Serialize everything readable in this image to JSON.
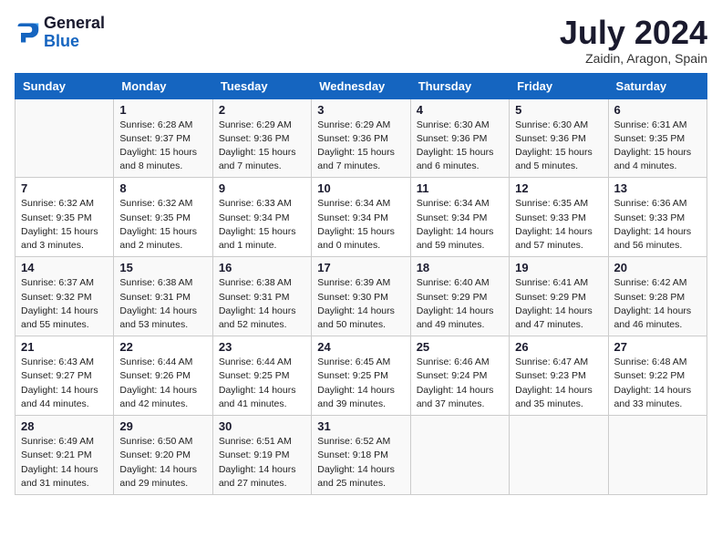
{
  "header": {
    "logo_line1": "General",
    "logo_line2": "Blue",
    "month": "July 2024",
    "location": "Zaidin, Aragon, Spain"
  },
  "days_of_week": [
    "Sunday",
    "Monday",
    "Tuesday",
    "Wednesday",
    "Thursday",
    "Friday",
    "Saturday"
  ],
  "weeks": [
    [
      {
        "num": "",
        "detail": ""
      },
      {
        "num": "1",
        "detail": "Sunrise: 6:28 AM\nSunset: 9:37 PM\nDaylight: 15 hours\nand 8 minutes."
      },
      {
        "num": "2",
        "detail": "Sunrise: 6:29 AM\nSunset: 9:36 PM\nDaylight: 15 hours\nand 7 minutes."
      },
      {
        "num": "3",
        "detail": "Sunrise: 6:29 AM\nSunset: 9:36 PM\nDaylight: 15 hours\nand 7 minutes."
      },
      {
        "num": "4",
        "detail": "Sunrise: 6:30 AM\nSunset: 9:36 PM\nDaylight: 15 hours\nand 6 minutes."
      },
      {
        "num": "5",
        "detail": "Sunrise: 6:30 AM\nSunset: 9:36 PM\nDaylight: 15 hours\nand 5 minutes."
      },
      {
        "num": "6",
        "detail": "Sunrise: 6:31 AM\nSunset: 9:35 PM\nDaylight: 15 hours\nand 4 minutes."
      }
    ],
    [
      {
        "num": "7",
        "detail": "Sunrise: 6:32 AM\nSunset: 9:35 PM\nDaylight: 15 hours\nand 3 minutes."
      },
      {
        "num": "8",
        "detail": "Sunrise: 6:32 AM\nSunset: 9:35 PM\nDaylight: 15 hours\nand 2 minutes."
      },
      {
        "num": "9",
        "detail": "Sunrise: 6:33 AM\nSunset: 9:34 PM\nDaylight: 15 hours\nand 1 minute."
      },
      {
        "num": "10",
        "detail": "Sunrise: 6:34 AM\nSunset: 9:34 PM\nDaylight: 15 hours\nand 0 minutes."
      },
      {
        "num": "11",
        "detail": "Sunrise: 6:34 AM\nSunset: 9:34 PM\nDaylight: 14 hours\nand 59 minutes."
      },
      {
        "num": "12",
        "detail": "Sunrise: 6:35 AM\nSunset: 9:33 PM\nDaylight: 14 hours\nand 57 minutes."
      },
      {
        "num": "13",
        "detail": "Sunrise: 6:36 AM\nSunset: 9:33 PM\nDaylight: 14 hours\nand 56 minutes."
      }
    ],
    [
      {
        "num": "14",
        "detail": "Sunrise: 6:37 AM\nSunset: 9:32 PM\nDaylight: 14 hours\nand 55 minutes."
      },
      {
        "num": "15",
        "detail": "Sunrise: 6:38 AM\nSunset: 9:31 PM\nDaylight: 14 hours\nand 53 minutes."
      },
      {
        "num": "16",
        "detail": "Sunrise: 6:38 AM\nSunset: 9:31 PM\nDaylight: 14 hours\nand 52 minutes."
      },
      {
        "num": "17",
        "detail": "Sunrise: 6:39 AM\nSunset: 9:30 PM\nDaylight: 14 hours\nand 50 minutes."
      },
      {
        "num": "18",
        "detail": "Sunrise: 6:40 AM\nSunset: 9:29 PM\nDaylight: 14 hours\nand 49 minutes."
      },
      {
        "num": "19",
        "detail": "Sunrise: 6:41 AM\nSunset: 9:29 PM\nDaylight: 14 hours\nand 47 minutes."
      },
      {
        "num": "20",
        "detail": "Sunrise: 6:42 AM\nSunset: 9:28 PM\nDaylight: 14 hours\nand 46 minutes."
      }
    ],
    [
      {
        "num": "21",
        "detail": "Sunrise: 6:43 AM\nSunset: 9:27 PM\nDaylight: 14 hours\nand 44 minutes."
      },
      {
        "num": "22",
        "detail": "Sunrise: 6:44 AM\nSunset: 9:26 PM\nDaylight: 14 hours\nand 42 minutes."
      },
      {
        "num": "23",
        "detail": "Sunrise: 6:44 AM\nSunset: 9:25 PM\nDaylight: 14 hours\nand 41 minutes."
      },
      {
        "num": "24",
        "detail": "Sunrise: 6:45 AM\nSunset: 9:25 PM\nDaylight: 14 hours\nand 39 minutes."
      },
      {
        "num": "25",
        "detail": "Sunrise: 6:46 AM\nSunset: 9:24 PM\nDaylight: 14 hours\nand 37 minutes."
      },
      {
        "num": "26",
        "detail": "Sunrise: 6:47 AM\nSunset: 9:23 PM\nDaylight: 14 hours\nand 35 minutes."
      },
      {
        "num": "27",
        "detail": "Sunrise: 6:48 AM\nSunset: 9:22 PM\nDaylight: 14 hours\nand 33 minutes."
      }
    ],
    [
      {
        "num": "28",
        "detail": "Sunrise: 6:49 AM\nSunset: 9:21 PM\nDaylight: 14 hours\nand 31 minutes."
      },
      {
        "num": "29",
        "detail": "Sunrise: 6:50 AM\nSunset: 9:20 PM\nDaylight: 14 hours\nand 29 minutes."
      },
      {
        "num": "30",
        "detail": "Sunrise: 6:51 AM\nSunset: 9:19 PM\nDaylight: 14 hours\nand 27 minutes."
      },
      {
        "num": "31",
        "detail": "Sunrise: 6:52 AM\nSunset: 9:18 PM\nDaylight: 14 hours\nand 25 minutes."
      },
      {
        "num": "",
        "detail": ""
      },
      {
        "num": "",
        "detail": ""
      },
      {
        "num": "",
        "detail": ""
      }
    ]
  ]
}
